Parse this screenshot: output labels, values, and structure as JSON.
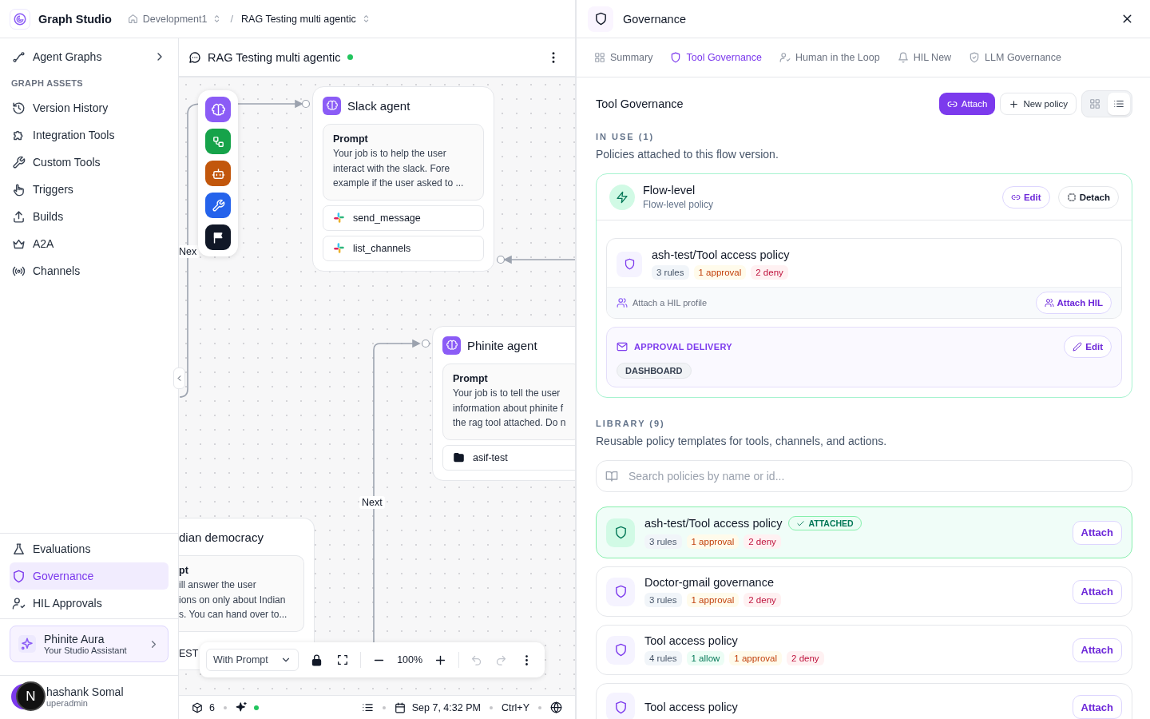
{
  "app": {
    "name": "Graph Studio"
  },
  "breadcrumbs": [
    {
      "label": "Development1",
      "kind": "workspace"
    },
    {
      "label": "RAG Testing multi agentic",
      "kind": "flow"
    }
  ],
  "breadcrumb_separator": "/",
  "sidebar": {
    "top_items": [
      {
        "label": "Agent Graphs",
        "selected": false
      }
    ],
    "section_label": "GRAPH ASSETS",
    "asset_items": [
      {
        "label": "Version History",
        "selected": false
      },
      {
        "label": "Integration Tools",
        "selected": false
      },
      {
        "label": "Custom Tools",
        "selected": false
      },
      {
        "label": "Triggers",
        "selected": false
      },
      {
        "label": "Builds",
        "selected": false
      },
      {
        "label": "A2A",
        "selected": false
      },
      {
        "label": "Channels",
        "selected": false
      }
    ],
    "bottom_items": [
      {
        "label": "Evaluations",
        "selected": false
      },
      {
        "label": "Governance",
        "selected": true
      },
      {
        "label": "HIL Approvals",
        "selected": false
      }
    ],
    "assistant": {
      "title": "Phinite Aura",
      "subtitle": "Your Studio Assistant"
    },
    "user": {
      "name": "hashank Somal",
      "role": "uperadmin"
    },
    "overlay_badge": "N"
  },
  "canvas": {
    "title": "RAG Testing multi agentic",
    "live": true,
    "nodes": [
      {
        "kind": "agent",
        "title": "Slack agent",
        "prompt_label": "Prompt",
        "prompt": "Your job is to help the user\ninteract with the slack. Fore\nexample if the user asked to ...",
        "tools": [
          {
            "name": "send_message",
            "kind": "slack"
          },
          {
            "name": "list_channels",
            "kind": "slack"
          }
        ]
      },
      {
        "kind": "agent",
        "title": "Phinite agent",
        "prompt_label": "Prompt",
        "prompt": "Your job is to tell the user\ninformation about phinite f\nthe rag tool attached. Do n",
        "tools": [
          {
            "name": "asif-test",
            "kind": "folder"
          }
        ]
      },
      {
        "kind": "partial",
        "title": "dian democracy",
        "prompt_label": "pt",
        "prompt": "ill answer the user\nions on only about Indian\ns. You can hand over to...",
        "footer": "EST"
      }
    ],
    "edge_labels": [
      "Nex",
      "Next"
    ],
    "toolbar": {
      "mode": "With Prompt",
      "zoom": "100%",
      "undo_disabled": true,
      "redo_disabled": true
    },
    "status_bar": {
      "node_count": "6",
      "assistant_live": true,
      "timestamp": "Sep 7, 4:32 PM",
      "shortcut": "Ctrl+Y"
    }
  },
  "panel": {
    "title": "Governance",
    "tabs": [
      {
        "label": "Summary",
        "selected": false
      },
      {
        "label": "Tool Governance",
        "selected": true
      },
      {
        "label": "Human in the Loop",
        "selected": false
      },
      {
        "label": "HIL New",
        "selected": false
      },
      {
        "label": "LLM Governance",
        "selected": false
      }
    ],
    "section_title": "Tool Governance",
    "attach_label": "Attach",
    "new_policy_label": "New policy",
    "view_modes": [
      {
        "kind": "grid",
        "selected": false
      },
      {
        "kind": "list",
        "selected": true
      }
    ],
    "in_use": {
      "heading": "IN USE (1)",
      "description": "Policies attached to this flow version.",
      "scope": {
        "title": "Flow-level",
        "subtitle": "Flow-level policy",
        "edit_label": "Edit",
        "detach_label": "Detach"
      },
      "policy": {
        "name": "ash-test/Tool access policy",
        "tags": [
          {
            "label": "3 rules",
            "kind": "rules"
          },
          {
            "label": "1 approval",
            "kind": "approval"
          },
          {
            "label": "2 deny",
            "kind": "deny"
          }
        ],
        "hil_prompt": "Attach a HIL profile",
        "hil_button": "Attach HIL"
      },
      "delivery": {
        "heading": "APPROVAL DELIVERY",
        "edit_label": "Edit",
        "channels": [
          "DASHBOARD"
        ]
      }
    },
    "library": {
      "heading": "LIBRARY (9)",
      "description": "Reusable policy templates for tools, channels, and actions.",
      "search_placeholder": "Search policies by name or id...",
      "attached_label": "ATTACHED",
      "policies": [
        {
          "name": "ash-test/Tool access policy",
          "attached": true,
          "action": "Attach",
          "tags": [
            {
              "label": "3 rules",
              "kind": "rules"
            },
            {
              "label": "1 approval",
              "kind": "approval"
            },
            {
              "label": "2 deny",
              "kind": "deny"
            }
          ]
        },
        {
          "name": "Doctor-gmail governance",
          "attached": false,
          "action": "Attach",
          "tags": [
            {
              "label": "3 rules",
              "kind": "rules"
            },
            {
              "label": "1 approval",
              "kind": "approval"
            },
            {
              "label": "2 deny",
              "kind": "deny"
            }
          ]
        },
        {
          "name": "Tool access policy",
          "attached": false,
          "action": "Attach",
          "tags": [
            {
              "label": "4 rules",
              "kind": "rules"
            },
            {
              "label": "1 allow",
              "kind": "allow"
            },
            {
              "label": "1 approval",
              "kind": "approval"
            },
            {
              "label": "2 deny",
              "kind": "deny"
            }
          ]
        },
        {
          "name": "Tool access policy",
          "attached": false,
          "action": "Attach"
        }
      ]
    }
  }
}
